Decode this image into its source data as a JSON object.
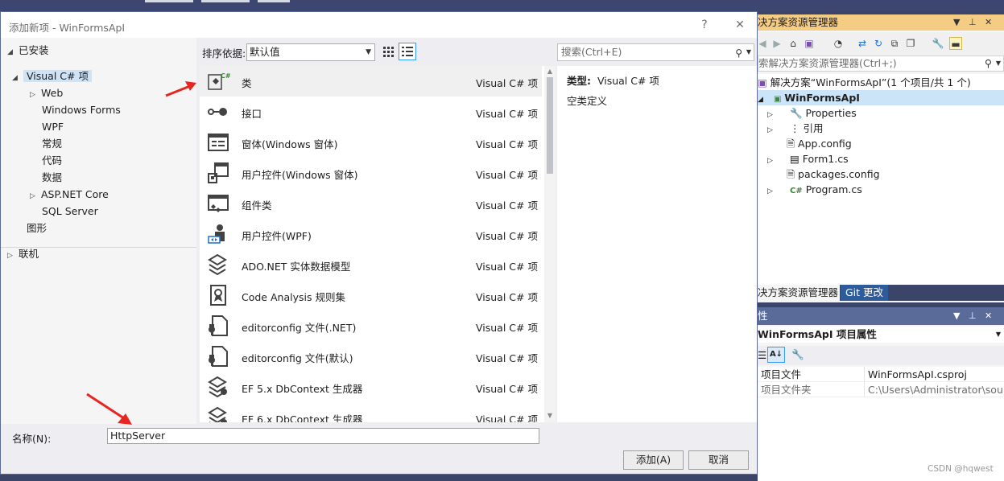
{
  "dialog": {
    "title": "添加新项 - WinFormsApI",
    "help": "?",
    "close": "✕"
  },
  "left_tree": {
    "installed": "已安装",
    "selected": "Visual C# 项",
    "children": [
      "Web",
      "Windows Forms",
      "WPF",
      "常规",
      "代码",
      "数据",
      "ASP.NET Core",
      "SQL Server"
    ],
    "graphics": "图形",
    "online": "联机"
  },
  "toolbar": {
    "sort_label": "排序依据:",
    "sort_value": "默认值",
    "search_placeholder": "搜索(Ctrl+E)"
  },
  "items": [
    {
      "name": "类",
      "lang": "Visual C# 项",
      "icon": "class-icon"
    },
    {
      "name": "接口",
      "lang": "Visual C# 项",
      "icon": "interface-icon"
    },
    {
      "name": "窗体(Windows 窗体)",
      "lang": "Visual C# 项",
      "icon": "form-icon"
    },
    {
      "name": "用户控件(Windows 窗体)",
      "lang": "Visual C# 项",
      "icon": "user-control-icon"
    },
    {
      "name": "组件类",
      "lang": "Visual C# 项",
      "icon": "component-icon"
    },
    {
      "name": "用户控件(WPF)",
      "lang": "Visual C# 项",
      "icon": "wpf-user-control-icon"
    },
    {
      "name": "ADO.NET 实体数据模型",
      "lang": "Visual C# 项",
      "icon": "data-model-icon"
    },
    {
      "name": "Code Analysis 规则集",
      "lang": "Visual C# 项",
      "icon": "ruleset-icon"
    },
    {
      "name": "editorconfig 文件(.NET)",
      "lang": "Visual C# 项",
      "icon": "config-file-icon"
    },
    {
      "name": "editorconfig 文件(默认)",
      "lang": "Visual C# 项",
      "icon": "config-file-icon"
    },
    {
      "name": "EF 5.x DbContext 生成器",
      "lang": "Visual C# 项",
      "icon": "generator-icon"
    },
    {
      "name": "EF 6.x DbContext 生成器",
      "lang": "Visual C# 项",
      "icon": "generator-icon"
    }
  ],
  "detail": {
    "type_label": "类型:",
    "type_value": "Visual C# 项",
    "description": "空类定义"
  },
  "bottom": {
    "name_label": "名称(N):",
    "name_value": "HttpServer",
    "add_button": "添加(A)",
    "cancel_button": "取消"
  },
  "solution_explorer": {
    "title": "决方案资源管理器",
    "search_placeholder": "索解决方案资源管理器(Ctrl+;)",
    "solution": "解决方案“WinFormsApI”(1 个项目/共 1 个)",
    "project": "WinFormsApI",
    "nodes": [
      "Properties",
      "引用",
      "App.config",
      "Form1.cs",
      "packages.config",
      "Program.cs"
    ],
    "tab_se": "决方案资源管理器",
    "tab_git": "Git 更改"
  },
  "properties": {
    "title": "性",
    "object": "WinFormsApI  项目属性",
    "rows": [
      {
        "key": "项目文件",
        "value": "WinFormsApI.csproj"
      },
      {
        "key": "项目文件夹",
        "value": "C:\\Users\\Administrator\\sou"
      }
    ]
  },
  "watermark": "CSDN @hqwest",
  "colors": {
    "accent": "#3399ff",
    "se_title": "#f5cc84",
    "arrow": "#e8251f",
    "csharp_green": "#388a34"
  }
}
